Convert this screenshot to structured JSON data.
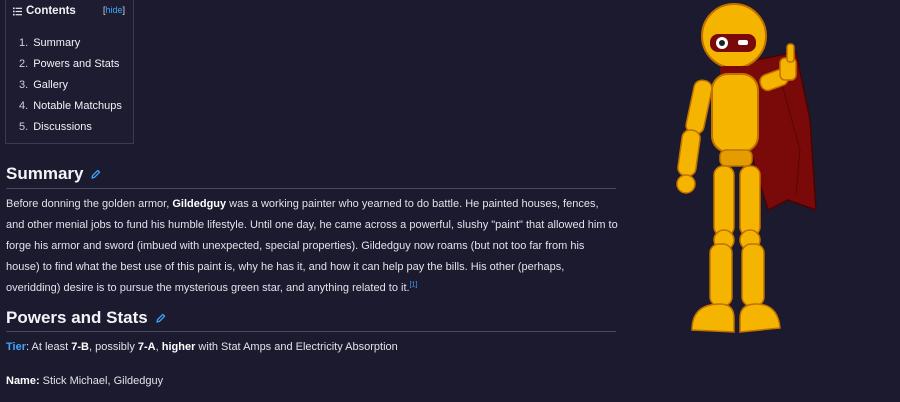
{
  "toc": {
    "title": "Contents",
    "toggle_open": "[",
    "toggle_label": "hide",
    "toggle_close": "]",
    "items": [
      {
        "num": "1.",
        "label": "Summary"
      },
      {
        "num": "2.",
        "label": "Powers and Stats"
      },
      {
        "num": "3.",
        "label": "Gallery"
      },
      {
        "num": "4.",
        "label": "Notable Matchups"
      },
      {
        "num": "5.",
        "label": "Discussions"
      }
    ]
  },
  "summary": {
    "heading": "Summary",
    "p1": "Before donning the golden armor, ",
    "name": "Gildedguy",
    "p2": " was a working painter who yearned to do battle. He painted houses, fences, and other menial jobs to fund his humble lifestyle. Until one day, he came across a powerful, slushy \"paint\" that allowed him to forge his armor and sword (imbued with unexpected, special properties). Gildedguy now roams (but not too far from his house) to find what the best use of this paint is, why he has it, and how it can help pay the bills. His other (perhaps, overidding) desire is to pursue the mysterious green star, and anything related to it.",
    "cite": "[1]"
  },
  "powers": {
    "heading": "Powers and Stats",
    "tier_label": "Tier",
    "tier_colon": ": At least ",
    "tier_a": "7-B",
    "tier_mid": ", possibly ",
    "tier_b": "7-A",
    "tier_sep": ", ",
    "tier_higher": "higher",
    "tier_rest": " with Stat Amps and Electricity Absorption",
    "name_label": "Name:",
    "name_value": " Stick Michael, Gildedguy"
  },
  "colors": {
    "background": "#1b1a2e",
    "link": "#3ea6ff",
    "armor": "#f5b400",
    "cape": "#7a0a0a"
  }
}
